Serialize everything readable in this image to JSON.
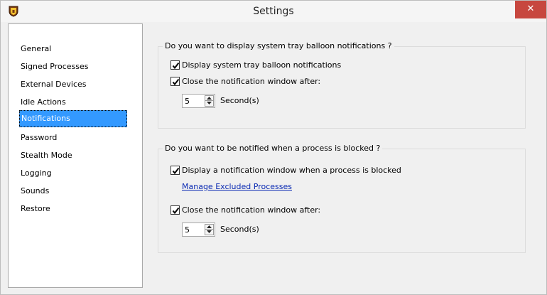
{
  "window": {
    "title": "Settings",
    "close_glyph": "✕"
  },
  "sidebar": {
    "items": [
      {
        "label": "General"
      },
      {
        "label": "Signed Processes"
      },
      {
        "label": "External Devices"
      },
      {
        "label": "Idle Actions"
      },
      {
        "label": "Notifications",
        "selected": true
      },
      {
        "label": "Password"
      },
      {
        "label": "Stealth Mode"
      },
      {
        "label": "Logging"
      },
      {
        "label": "Sounds"
      },
      {
        "label": "Restore"
      }
    ]
  },
  "tray_group": {
    "legend": "Do you want to display system tray balloon notifications ?",
    "display_balloon": {
      "label": "Display system tray balloon notifications",
      "checked": true
    },
    "close_after": {
      "label": "Close the notification window after:",
      "checked": true
    },
    "seconds_value": "5",
    "seconds_unit": "Second(s)"
  },
  "blocked_group": {
    "legend": "Do you want to be notified when a process is blocked ?",
    "display_window": {
      "label": "Display a notification window when a process is blocked",
      "checked": true
    },
    "manage_link": "Manage Excluded Processes",
    "close_after": {
      "label": "Close the notification window after:",
      "checked": true
    },
    "seconds_value": "5",
    "seconds_unit": "Second(s)"
  },
  "colors": {
    "selection": "#3399ff",
    "close_button": "#c7473f",
    "link": "#0a2ab3"
  },
  "icons": {
    "app": "shield-icon",
    "check": "check-icon",
    "spin_up": "arrow-up-icon",
    "spin_down": "arrow-down-icon"
  }
}
